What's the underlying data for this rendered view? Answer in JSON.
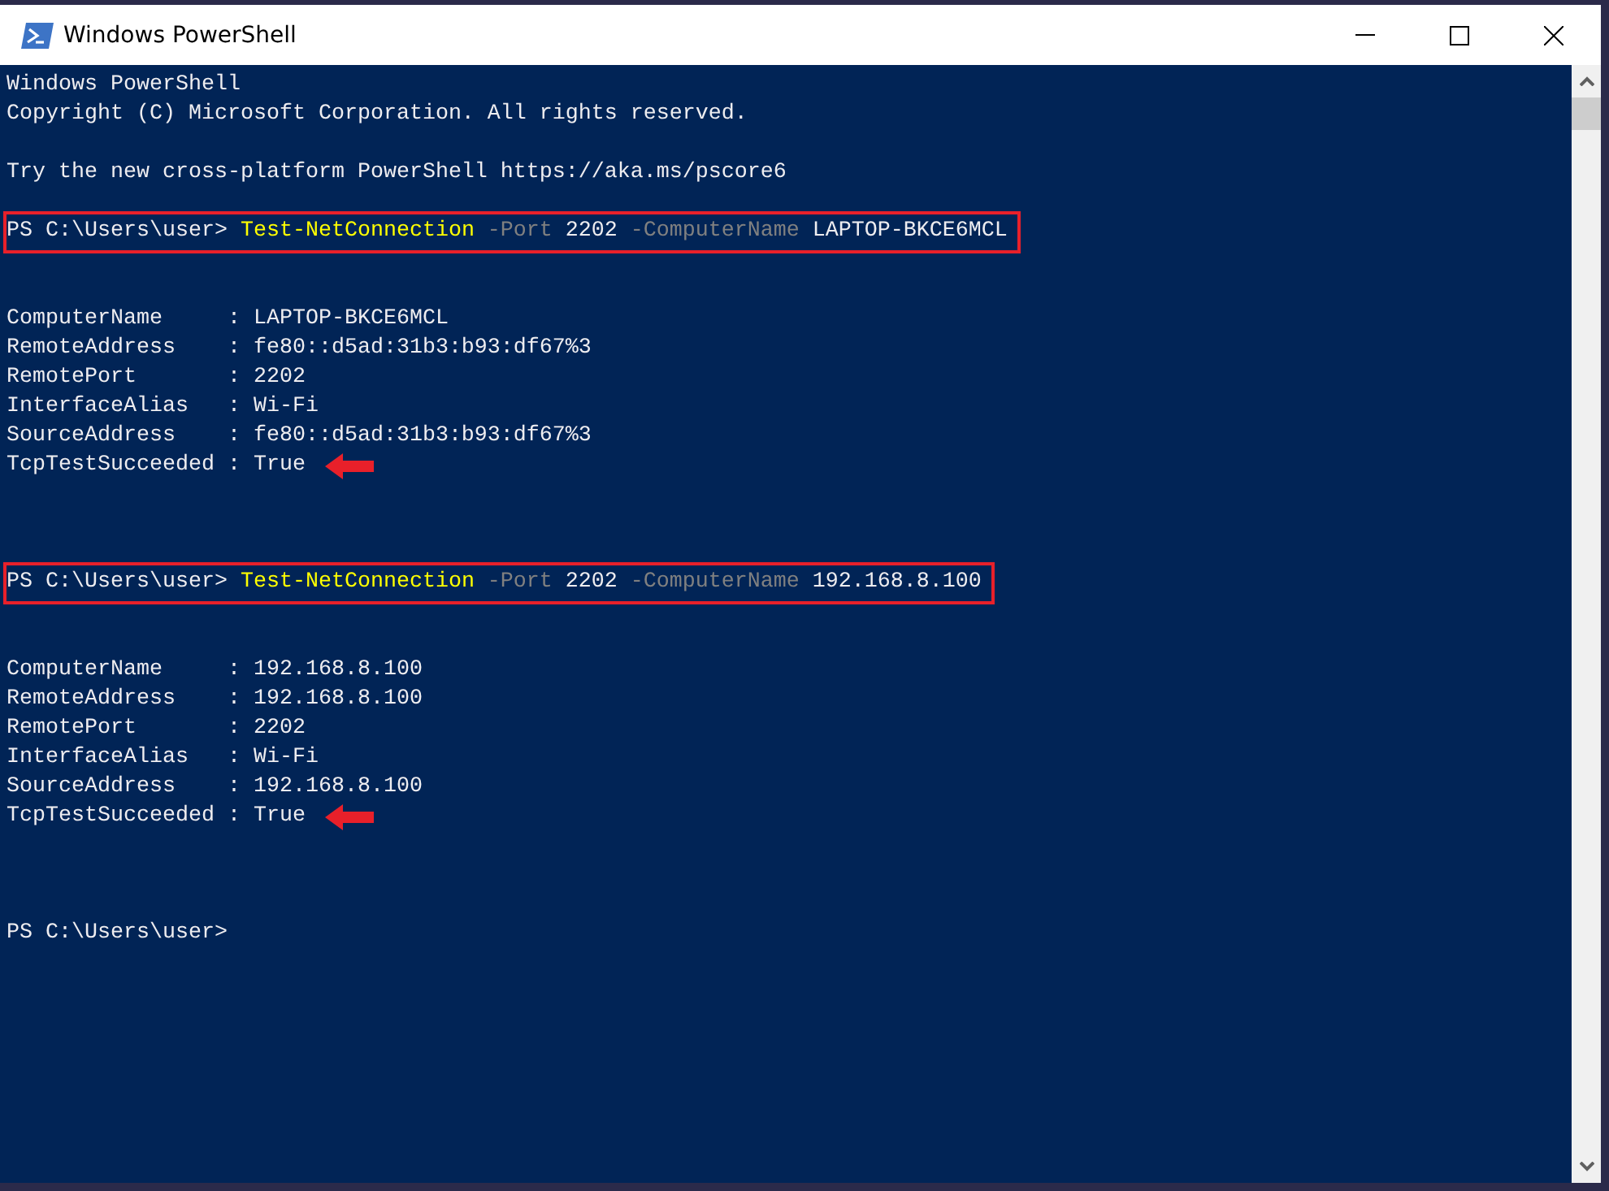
{
  "window": {
    "title": "Windows PowerShell"
  },
  "console": {
    "lines": [
      {
        "kind": "text",
        "segments": [
          {
            "text": "Windows PowerShell",
            "kind": "plain"
          }
        ]
      },
      {
        "kind": "text",
        "segments": [
          {
            "text": "Copyright (C) Microsoft Corporation. All rights reserved.",
            "kind": "plain"
          }
        ]
      },
      {
        "kind": "blank"
      },
      {
        "kind": "text",
        "segments": [
          {
            "text": "Try the new cross-platform PowerShell https://aka.ms/pscore6",
            "kind": "plain"
          }
        ]
      },
      {
        "kind": "blank"
      },
      {
        "kind": "text",
        "highlighted": true,
        "segments": [
          {
            "text": "PS C:\\Users\\user> ",
            "kind": "plain"
          },
          {
            "text": "Test-NetConnection",
            "kind": "command"
          },
          {
            "text": " -Port",
            "kind": "parameter"
          },
          {
            "text": " 2202",
            "kind": "plain"
          },
          {
            "text": " -ComputerName",
            "kind": "parameter"
          },
          {
            "text": " LAPTOP-BKCE6MCL",
            "kind": "plain"
          }
        ]
      },
      {
        "kind": "blank"
      },
      {
        "kind": "blank"
      },
      {
        "kind": "text",
        "segments": [
          {
            "text": "ComputerName     : LAPTOP-BKCE6MCL",
            "kind": "plain"
          }
        ]
      },
      {
        "kind": "text",
        "segments": [
          {
            "text": "RemoteAddress    : fe80::d5ad:31b3:b93:df67%3",
            "kind": "plain"
          }
        ]
      },
      {
        "kind": "text",
        "segments": [
          {
            "text": "RemotePort       : 2202",
            "kind": "plain"
          }
        ]
      },
      {
        "kind": "text",
        "segments": [
          {
            "text": "InterfaceAlias   : Wi-Fi",
            "kind": "plain"
          }
        ]
      },
      {
        "kind": "text",
        "segments": [
          {
            "text": "SourceAddress    : fe80::d5ad:31b3:b93:df67%3",
            "kind": "plain"
          }
        ]
      },
      {
        "kind": "text",
        "arrow": true,
        "segments": [
          {
            "text": "TcpTestSucceeded : True",
            "kind": "plain"
          }
        ]
      },
      {
        "kind": "blank"
      },
      {
        "kind": "blank"
      },
      {
        "kind": "blank"
      },
      {
        "kind": "text",
        "highlighted": true,
        "segments": [
          {
            "text": "PS C:\\Users\\user> ",
            "kind": "plain"
          },
          {
            "text": "Test-NetConnection",
            "kind": "command"
          },
          {
            "text": " -Port",
            "kind": "parameter"
          },
          {
            "text": " 2202",
            "kind": "plain"
          },
          {
            "text": " -ComputerName",
            "kind": "parameter"
          },
          {
            "text": " 192.168.8.100",
            "kind": "plain"
          }
        ]
      },
      {
        "kind": "blank"
      },
      {
        "kind": "blank"
      },
      {
        "kind": "text",
        "segments": [
          {
            "text": "ComputerName     : 192.168.8.100",
            "kind": "plain"
          }
        ]
      },
      {
        "kind": "text",
        "segments": [
          {
            "text": "RemoteAddress    : 192.168.8.100",
            "kind": "plain"
          }
        ]
      },
      {
        "kind": "text",
        "segments": [
          {
            "text": "RemotePort       : 2202",
            "kind": "plain"
          }
        ]
      },
      {
        "kind": "text",
        "segments": [
          {
            "text": "InterfaceAlias   : Wi-Fi",
            "kind": "plain"
          }
        ]
      },
      {
        "kind": "text",
        "segments": [
          {
            "text": "SourceAddress    : 192.168.8.100",
            "kind": "plain"
          }
        ]
      },
      {
        "kind": "text",
        "arrow": true,
        "segments": [
          {
            "text": "TcpTestSucceeded : True",
            "kind": "plain"
          }
        ]
      },
      {
        "kind": "blank"
      },
      {
        "kind": "blank"
      },
      {
        "kind": "blank"
      },
      {
        "kind": "text",
        "segments": [
          {
            "text": "PS C:\\Users\\user>",
            "kind": "plain"
          }
        ]
      }
    ]
  }
}
